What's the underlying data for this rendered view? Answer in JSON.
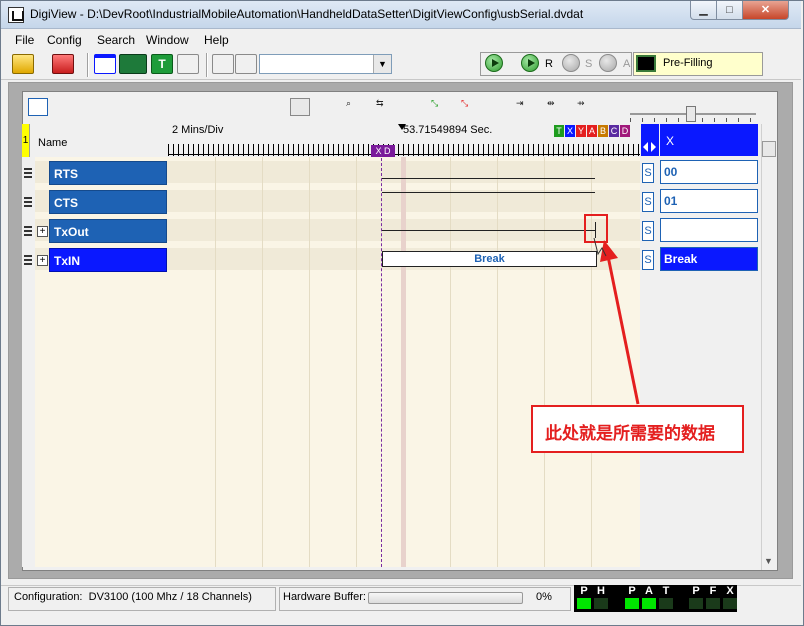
{
  "window": {
    "app_name": "DigiView",
    "title": "DigiView - D:\\DevRoot\\IndustrialMobileAutomation\\HandheldDataSetter\\DigitViewConfig\\usbSerial.dvdat",
    "min_label": "▁",
    "max_label": "□",
    "close_label": "✕"
  },
  "menu": [
    "File",
    "Config",
    "Search",
    "Window",
    "Help"
  ],
  "toolbar": {
    "icons": [
      "open-icon",
      "save-icon",
      "window-icon",
      "channels-icon",
      "text-icon",
      "export-icon",
      "capture-config-icon",
      "capture-settings-icon"
    ],
    "combo_value": "",
    "combo_arrow": "▼",
    "run_letter": "R",
    "stop_letter": "S",
    "abort_letter": "A",
    "status_text": "Pre-Filling"
  },
  "waveform": {
    "timebase": "2 Mins/Div",
    "cursor_time": "53.71549894 Sec.",
    "name_header": "Name",
    "trigger_marker": "X D",
    "yellow_marker": "1",
    "color_tags": [
      {
        "t": "T",
        "c": "#1e9c1e"
      },
      {
        "t": "X",
        "c": "#0a18ff"
      },
      {
        "t": "Y",
        "c": "#e41f1f"
      },
      {
        "t": "A",
        "c": "#e41f1f"
      },
      {
        "t": "B",
        "c": "#c87a00"
      },
      {
        "t": "C",
        "c": "#5a2aa0"
      },
      {
        "t": "D",
        "c": "#a0187a"
      }
    ],
    "value_header": "X",
    "signals": [
      {
        "name": "RTS",
        "value": "00",
        "expandable": false,
        "selected": false
      },
      {
        "name": "CTS",
        "value": "01",
        "expandable": false,
        "selected": false
      },
      {
        "name": "TxOut",
        "value": "",
        "expandable": true,
        "selected": false
      },
      {
        "name": "TxIN",
        "value": "Break",
        "expandable": true,
        "selected": true
      }
    ],
    "txin_segment": "Break",
    "s_button": "S"
  },
  "annotation": {
    "callout_text": "此处就是所需要的数据"
  },
  "statusbar": {
    "configuration_label": "Configuration:",
    "configuration_value": "DV3100 (100 Mhz / 18 Channels)",
    "hw_buffer_label": "Hardware Buffer:",
    "hw_buffer_percent": "0%",
    "hw_buffer_fill": 0,
    "flags": [
      {
        "letter": "P",
        "on": true
      },
      {
        "letter": "H",
        "on": false
      },
      {
        "letter": "P",
        "on": true
      },
      {
        "letter": "A",
        "on": true
      },
      {
        "letter": "T",
        "on": false
      },
      {
        "letter": "P",
        "on": false
      },
      {
        "letter": "F",
        "on": false
      },
      {
        "letter": "X",
        "on": false
      }
    ]
  },
  "colors": {
    "signal_blue": "#1e62b4",
    "selected_blue": "#0a18ff",
    "annotation_red": "#e41f1f"
  }
}
